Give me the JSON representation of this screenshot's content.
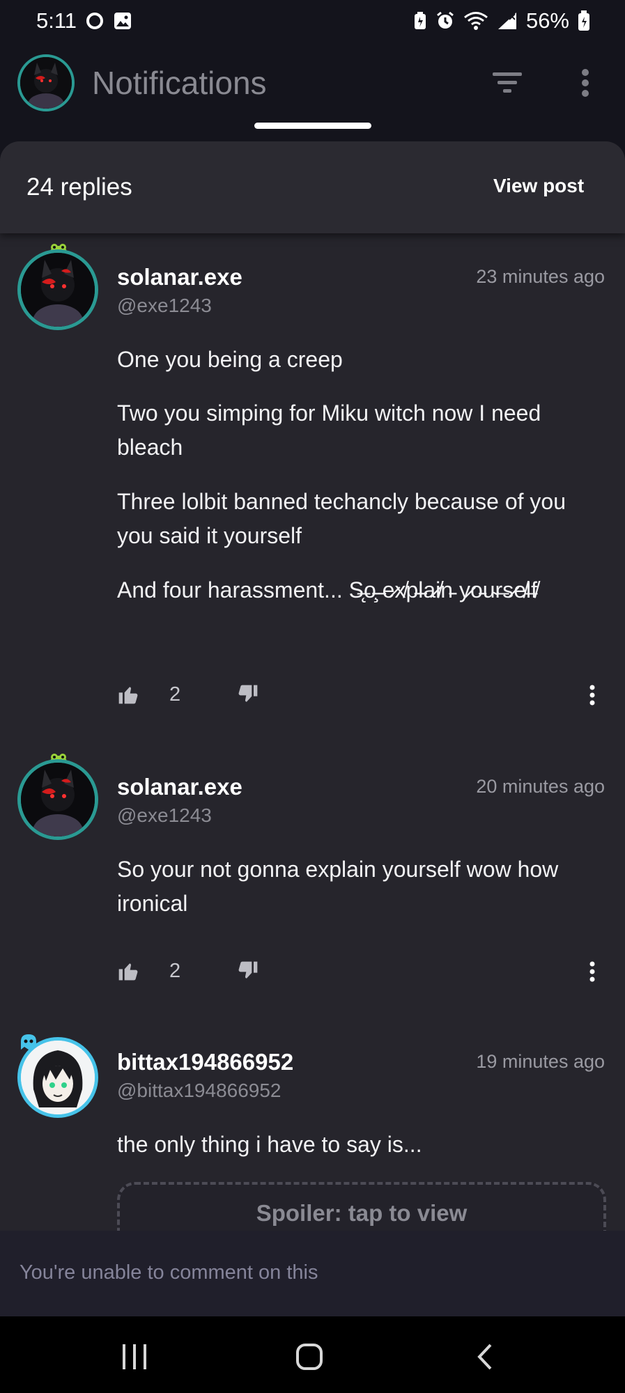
{
  "status_bar": {
    "time": "5:11",
    "battery": "56%"
  },
  "app_bar": {
    "title": "Notifications"
  },
  "sheet": {
    "replies_count": "24 replies",
    "view_post_label": "View post"
  },
  "comments": [
    {
      "name": "solanar.exe",
      "handle": "@exe1243",
      "time": "23 minutes ago",
      "paragraphs": [
        "One you being a creep",
        "Two you simping for Miku witch now I need bleach",
        "Three lolbit banned techancly because of you you said it yourself",
        "And four harassment... S̶̨o̵̧ ̵e̷x̸p̵l̵a̷i̸n̵ y̷o̵u̴r̶s̷e̸l̶f̸"
      ],
      "likes": "2"
    },
    {
      "name": "solanar.exe",
      "handle": "@exe1243",
      "time": "20 minutes ago",
      "paragraphs": [
        "So your not gonna explain yourself wow how ironical"
      ],
      "likes": "2"
    },
    {
      "name": "bittax194866952",
      "handle": "@bittax194866952",
      "time": "19 minutes ago",
      "paragraphs": [
        "the only thing i have to say is..."
      ],
      "spoiler_label": "Spoiler: tap to view"
    }
  ],
  "composer": {
    "placeholder": "You're unable to comment on this"
  },
  "icons": [
    "record-icon",
    "image-icon",
    "battery-saver-icon",
    "alarm-icon",
    "wifi-icon",
    "signal-icon",
    "battery-icon",
    "filter-icon",
    "more-vert-icon",
    "thumbs-up-icon",
    "thumbs-down-icon",
    "recents-icon",
    "home-icon",
    "back-icon"
  ],
  "colors": {
    "background": "#14141c",
    "sheet": "#26252c",
    "accent_teal": "#2a9a93",
    "accent_blue": "#46c3e9"
  }
}
